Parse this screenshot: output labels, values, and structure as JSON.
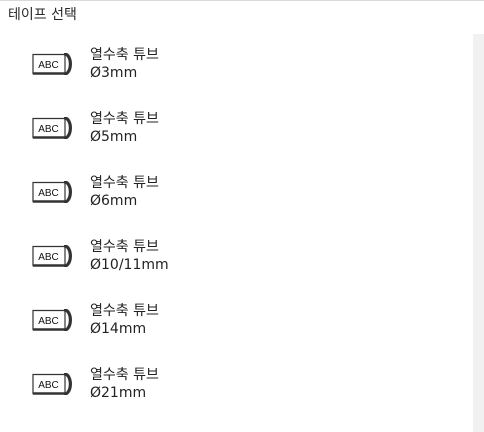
{
  "panel": {
    "title": "테이프 선택"
  },
  "tape_icon": {
    "label": "ABC",
    "icon": "label-tape-icon"
  },
  "items": [
    {
      "name": "열수축 튜브",
      "size": "Ø3mm"
    },
    {
      "name": "열수축 튜브",
      "size": "Ø5mm"
    },
    {
      "name": "열수축 튜브",
      "size": "Ø6mm"
    },
    {
      "name": "열수축 튜브",
      "size": "Ø10/11mm"
    },
    {
      "name": "열수축 튜브",
      "size": "Ø14mm"
    },
    {
      "name": "열수축 튜브",
      "size": "Ø21mm"
    }
  ],
  "colors": {
    "text": "#222222",
    "divider": "#d9d9d9",
    "scrollbar_track": "#f1f1f1",
    "icon_stroke": "#333333"
  }
}
